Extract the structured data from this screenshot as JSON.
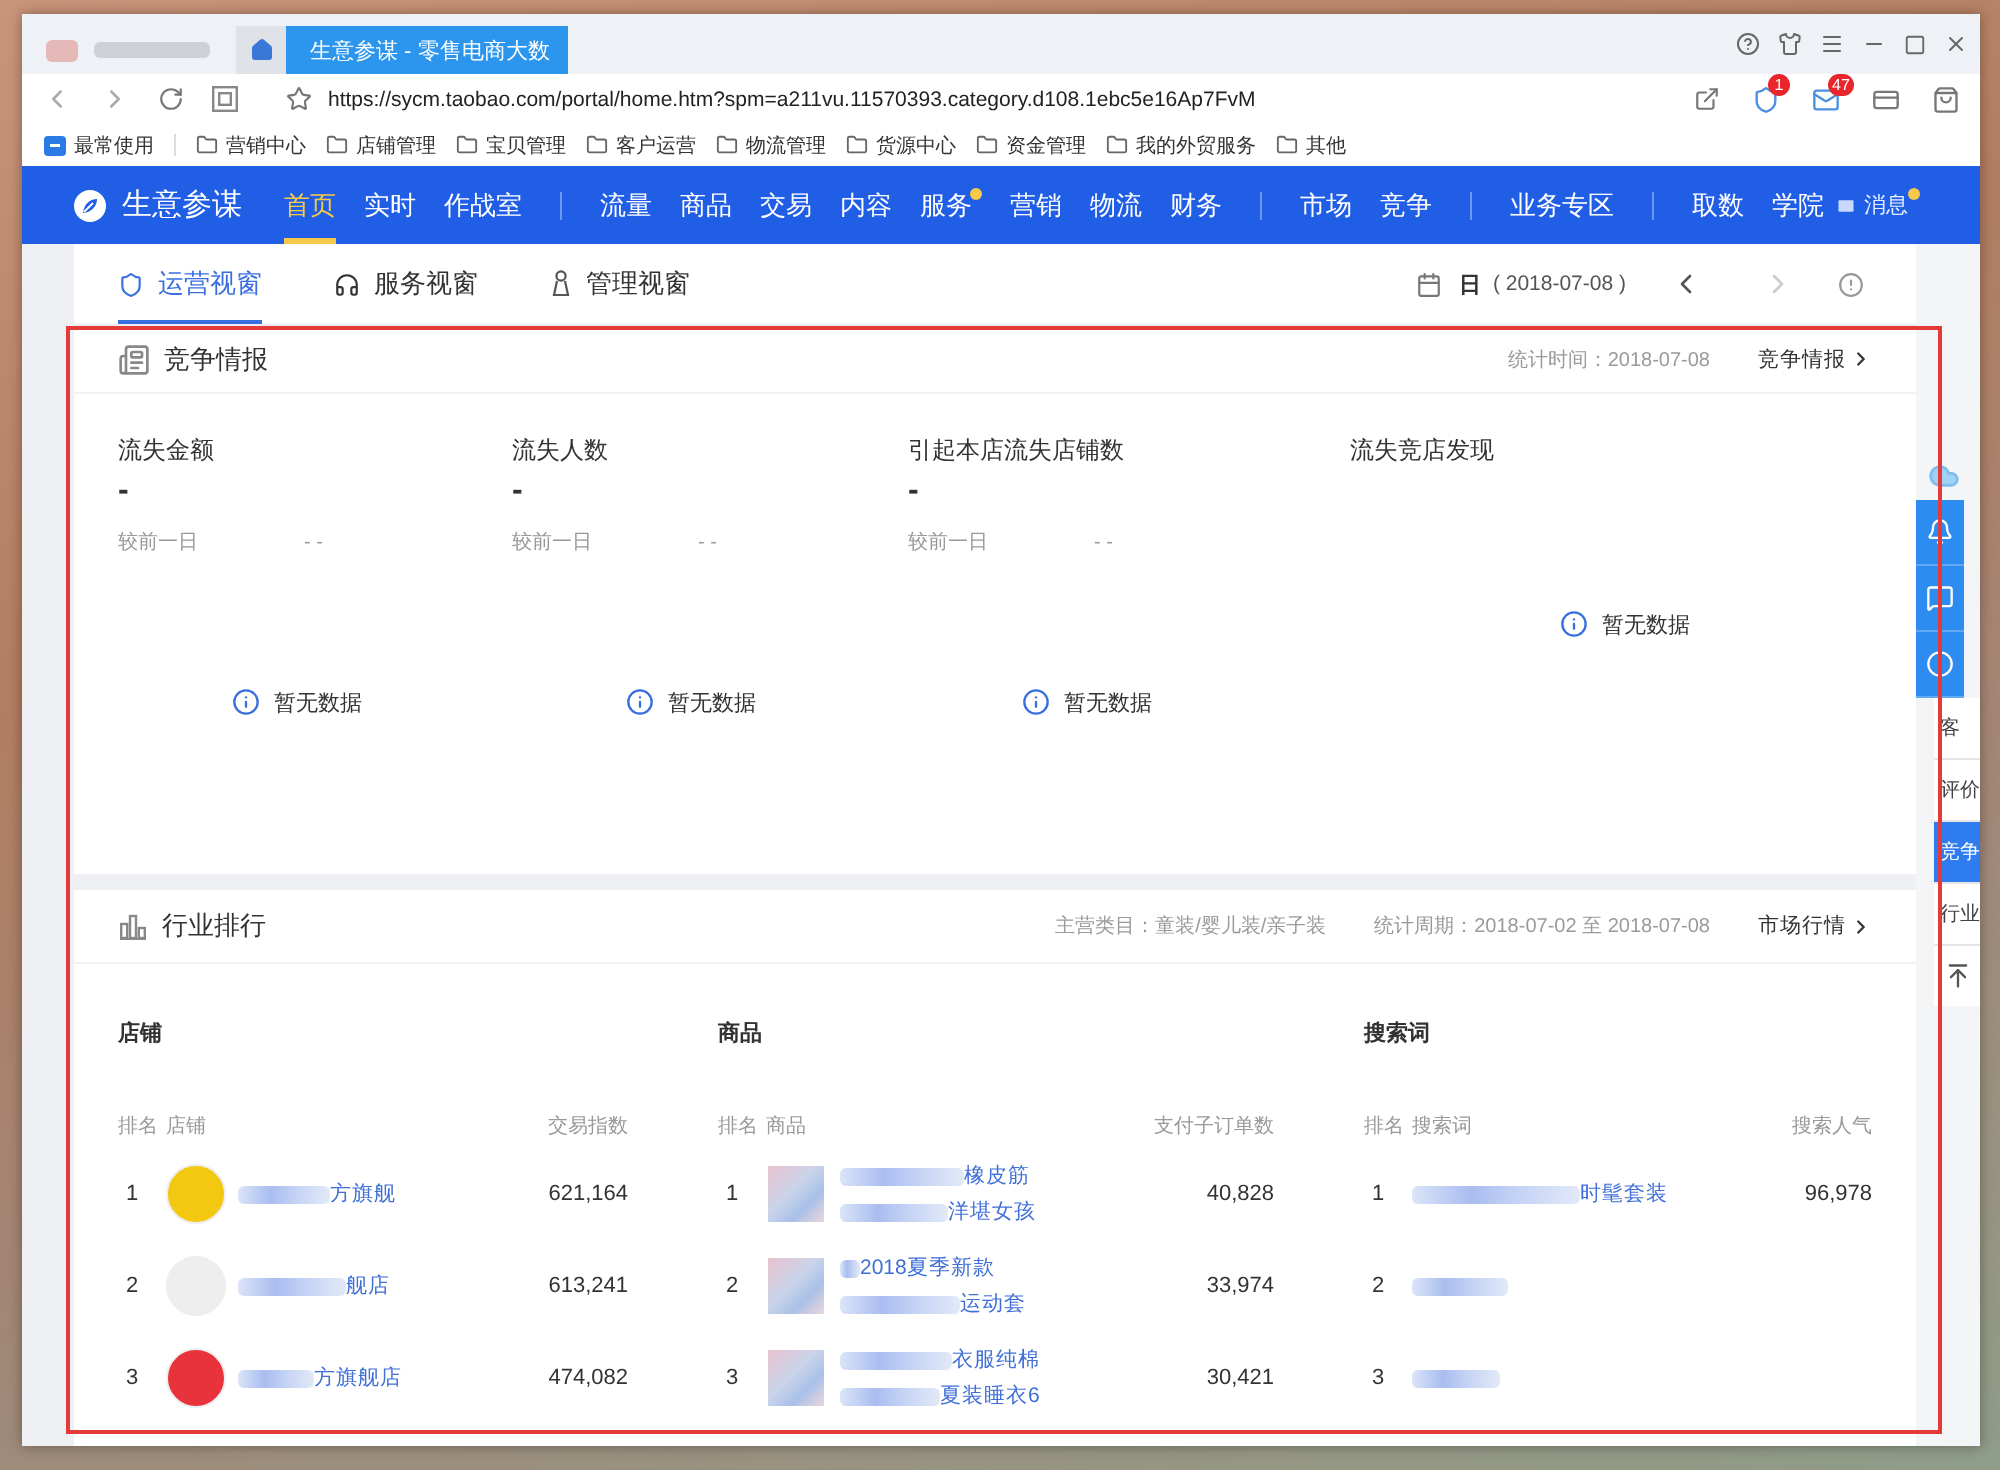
{
  "browser": {
    "tabs": [
      {
        "kind": "blurred",
        "selected": false
      },
      {
        "kind": "home",
        "selected": false
      },
      {
        "kind": "page",
        "title": "生意参谋 - 零售电商大数",
        "selected": true
      }
    ],
    "url": "https://sycm.taobao.com/portal/home.htm?spm=a211vu.11570393.category.d108.1ebc5e16Ap7FvM",
    "badges": {
      "shield": "1",
      "mail": "47"
    },
    "bookmarks": [
      {
        "kind": "frequent",
        "label": "最常使用"
      },
      {
        "kind": "folder",
        "label": "营销中心"
      },
      {
        "kind": "folder",
        "label": "店铺管理"
      },
      {
        "kind": "folder",
        "label": "宝贝管理"
      },
      {
        "kind": "folder",
        "label": "客户运营"
      },
      {
        "kind": "folder",
        "label": "物流管理"
      },
      {
        "kind": "folder",
        "label": "货源中心"
      },
      {
        "kind": "folder",
        "label": "资金管理"
      },
      {
        "kind": "folder",
        "label": "我的外贸服务"
      },
      {
        "kind": "folder",
        "label": "其他"
      }
    ]
  },
  "nav": {
    "brand": "生意参谋",
    "groups": [
      {
        "items": [
          {
            "label": "首页",
            "selected": true,
            "dot": false
          },
          {
            "label": "实时",
            "selected": false,
            "dot": false
          },
          {
            "label": "作战室",
            "selected": false,
            "dot": false
          }
        ]
      },
      {
        "items": [
          {
            "label": "流量",
            "selected": false,
            "dot": false
          },
          {
            "label": "商品",
            "selected": false,
            "dot": false
          },
          {
            "label": "交易",
            "selected": false,
            "dot": false
          },
          {
            "label": "内容",
            "selected": false,
            "dot": false
          },
          {
            "label": "服务",
            "selected": false,
            "dot": true
          },
          {
            "label": "营销",
            "selected": false,
            "dot": false
          },
          {
            "label": "物流",
            "selected": false,
            "dot": false
          },
          {
            "label": "财务",
            "selected": false,
            "dot": false
          }
        ]
      },
      {
        "items": [
          {
            "label": "市场",
            "selected": false,
            "dot": false
          },
          {
            "label": "竞争",
            "selected": false,
            "dot": false
          }
        ]
      },
      {
        "items": [
          {
            "label": "业务专区",
            "selected": false,
            "dot": false
          }
        ]
      },
      {
        "items": [
          {
            "label": "取数",
            "selected": false,
            "dot": false
          },
          {
            "label": "学院",
            "selected": false,
            "dot": false
          }
        ]
      }
    ],
    "messages": {
      "label": "消息",
      "unread": true
    }
  },
  "view_tabs": [
    {
      "kind": "operations",
      "label": "运营视窗",
      "selected": true
    },
    {
      "kind": "service",
      "label": "服务视窗",
      "selected": false
    },
    {
      "kind": "management",
      "label": "管理视窗",
      "selected": false
    }
  ],
  "date_picker": {
    "unit": "日",
    "date": "( 2018-07-08 )",
    "prev_disabled": false,
    "next_disabled": true
  },
  "competition": {
    "title": "竞争情报",
    "stat_time": "统计时间：2018-07-08",
    "link": "竞争情报",
    "metrics": [
      {
        "kind": "metric",
        "label": "流失金额",
        "value": "-",
        "compare_label": "较前一日",
        "compare_value": "- -",
        "empty": "暂无数据"
      },
      {
        "kind": "metric",
        "label": "流失人数",
        "value": "-",
        "compare_label": "较前一日",
        "compare_value": "- -",
        "empty": "暂无数据"
      },
      {
        "kind": "metric",
        "label": "引起本店流失店铺数",
        "value": "-",
        "compare_label": "较前一日",
        "compare_value": "- -",
        "empty": "暂无数据"
      },
      {
        "kind": "discovery",
        "label": "流失竞店发现",
        "empty": "暂无数据"
      }
    ]
  },
  "ranking": {
    "title": "行业排行",
    "category": "主营类目：童装/婴儿装/亲子装",
    "period": "统计周期：2018-07-02 至 2018-07-08",
    "link": "市场行情",
    "panels": [
      {
        "kind": "shop",
        "title": "店铺",
        "columns": [
          "排名",
          "店铺",
          "交易指数"
        ],
        "rows": [
          {
            "rank": "1",
            "color": "#f2c811",
            "name": "方旗舰",
            "value": "621,164"
          },
          {
            "rank": "2",
            "color": "#eeeeee",
            "name": "舰店",
            "value": "613,241"
          },
          {
            "rank": "3",
            "color": "#e8323c",
            "name": "方旗舰店",
            "value": "474,082"
          }
        ]
      },
      {
        "kind": "product",
        "title": "商品",
        "columns": [
          "排名",
          "商品",
          "支付子订单数"
        ],
        "rows": [
          {
            "rank": "1",
            "lines": [
              "橡皮筋",
              "洋堪女孩"
            ],
            "value": "40,828"
          },
          {
            "rank": "2",
            "lines": [
              "2018夏季新款",
              "运动套"
            ],
            "value": "33,974"
          },
          {
            "rank": "3",
            "lines": [
              "衣服纯棉",
              "夏装睡衣6"
            ],
            "value": "30,421"
          }
        ]
      },
      {
        "kind": "keyword",
        "title": "搜索词",
        "columns": [
          "排名",
          "搜索词",
          "搜索人气"
        ],
        "rows": [
          {
            "rank": "1",
            "name": "时髦套装",
            "value": "96,978"
          },
          {
            "rank": "2"
          },
          {
            "rank": "3"
          }
        ]
      }
    ]
  },
  "side_panel": {
    "items": [
      {
        "label": "客",
        "selected": false
      },
      {
        "label": "评价",
        "selected": false
      },
      {
        "label": "竞争",
        "selected": true
      },
      {
        "label": "行业",
        "selected": false
      }
    ]
  }
}
